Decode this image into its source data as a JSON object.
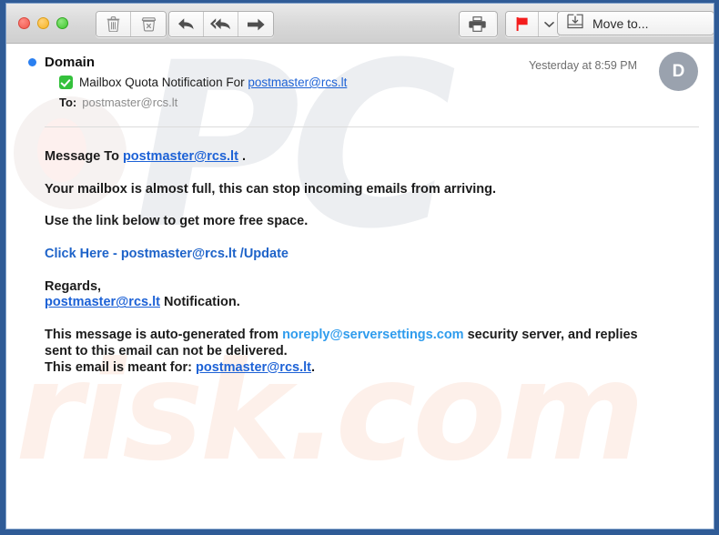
{
  "window": {
    "traffic_lights": [
      "close",
      "minimize",
      "zoom"
    ],
    "frame_color": "#2f5b96"
  },
  "toolbar": {
    "delete_button": "delete-icon",
    "junk_button": "junk-icon",
    "reply_button": "reply-icon",
    "reply_all_button": "reply-all-icon",
    "forward_button": "forward-icon",
    "print_button": "print-icon",
    "flag_button": "flag-icon",
    "flag_dropdown": "chevron-down-icon",
    "move_to_label": "Move to...",
    "flag_color": "#f41d1d"
  },
  "message": {
    "sender": "Domain",
    "unread": true,
    "subject_prefix": "Mailbox Quota Notification For ",
    "subject_link": "postmaster@rcs.lt",
    "to_label": "To:",
    "to_value": "postmaster@rcs.lt",
    "timestamp": "Yesterday at 8:59 PM",
    "avatar_initial": "D"
  },
  "body": {
    "line1_prefix": "Message To ",
    "line1_link": "postmaster@rcs.lt",
    "line1_suffix": " .",
    "line2": "Your mailbox is almost full, this can stop incoming emails from arriving.",
    "line3": "Use the link below to get more free space.",
    "cta_link": "Click Here - postmaster@rcs.lt /Update",
    "regards": "Regards,",
    "regards_link": "postmaster@rcs.lt",
    "regards_suffix": " Notification.",
    "footer1_prefix": "This message is auto-generated from ",
    "footer1_link": "noreply@serversettings.com",
    "footer1_suffix": " security server, and replies",
    "footer2": "sent to this email can not be delivered.",
    "footer3_prefix": "This email is meant for: ",
    "footer3_link": "postmaster@rcs.lt",
    "footer3_suffix": "."
  },
  "watermark": {
    "logo": "PC",
    "domain": "risk.com"
  }
}
